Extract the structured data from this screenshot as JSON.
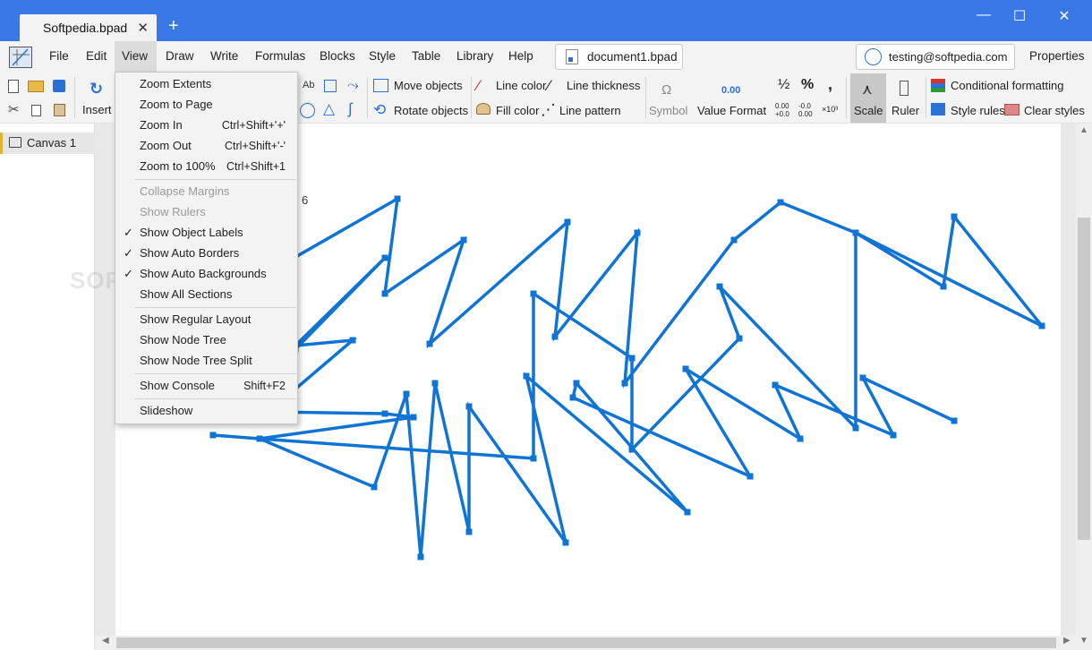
{
  "window": {
    "tab_title": "Softpedia.bpad",
    "tab_close": "✕",
    "new_tab": "+",
    "minimize": "—",
    "maximize": "☐",
    "close": "✕"
  },
  "menubar": {
    "items": [
      "File",
      "Edit",
      "View",
      "Draw",
      "Write",
      "Formulas",
      "Blocks",
      "Style",
      "Table",
      "Library",
      "Help"
    ],
    "active": "View",
    "document": "document1.bpad",
    "user": "testing@softpedia.com",
    "properties": "Properties"
  },
  "ribbon": {
    "insert": "Insert",
    "move_objects": "Move objects",
    "rotate_objects": "Rotate objects",
    "line_color": "Line color",
    "fill_color": "Fill color",
    "line_thickness": "Line thickness",
    "line_pattern": "Line pattern",
    "symbol": "Symbol",
    "symbol_glyph": "Ω",
    "value_format": "Value Format",
    "value_format_sample": "0.00",
    "fraction": "½",
    "percent": "%",
    "comma": ",",
    "dec_more": "0.00 +0.0",
    "dec_less": "-0.0 0.00",
    "sci": "×10³",
    "scale": "Scale",
    "ruler": "Ruler",
    "conditional_formatting": "Conditional formatting",
    "style_rules": "Style rules",
    "clear_styles": "Clear styles"
  },
  "sidebar": {
    "canvas_label": "Canvas 1"
  },
  "canvas": {
    "page_label": "6",
    "watermark": "SOFTPEDIA",
    "line_color": "#0f74d4"
  },
  "view_menu": {
    "items": [
      {
        "label": "Zoom Extents",
        "shortcut": "",
        "checked": false,
        "disabled": false
      },
      {
        "label": "Zoom to Page",
        "shortcut": "",
        "checked": false,
        "disabled": false
      },
      {
        "label": "Zoom In",
        "shortcut": "Ctrl+Shift+'+'",
        "checked": false,
        "disabled": false
      },
      {
        "label": "Zoom Out",
        "shortcut": "Ctrl+Shift+'-'",
        "checked": false,
        "disabled": false
      },
      {
        "label": "Zoom to 100%",
        "shortcut": "Ctrl+Shift+1",
        "checked": false,
        "disabled": false
      },
      {
        "label": "Collapse Margins",
        "shortcut": "",
        "checked": false,
        "disabled": true
      },
      {
        "label": "Show Rulers",
        "shortcut": "",
        "checked": false,
        "disabled": true
      },
      {
        "label": "Show Object Labels",
        "shortcut": "",
        "checked": true,
        "disabled": false
      },
      {
        "label": "Show Auto Borders",
        "shortcut": "",
        "checked": true,
        "disabled": false
      },
      {
        "label": "Show Auto Backgrounds",
        "shortcut": "",
        "checked": true,
        "disabled": false
      },
      {
        "label": "Show All Sections",
        "shortcut": "",
        "checked": false,
        "disabled": false
      },
      {
        "label": "Show Regular Layout",
        "shortcut": "",
        "checked": false,
        "disabled": false
      },
      {
        "label": "Show Node Tree",
        "shortcut": "",
        "checked": false,
        "disabled": false
      },
      {
        "label": "Show Node Tree Split",
        "shortcut": "",
        "checked": false,
        "disabled": false
      },
      {
        "label": "Show Console",
        "shortcut": "Shift+F2",
        "checked": false,
        "disabled": false
      },
      {
        "label": "Slideshow",
        "shortcut": "",
        "checked": false,
        "disabled": false
      }
    ],
    "check_glyph": "✓"
  }
}
